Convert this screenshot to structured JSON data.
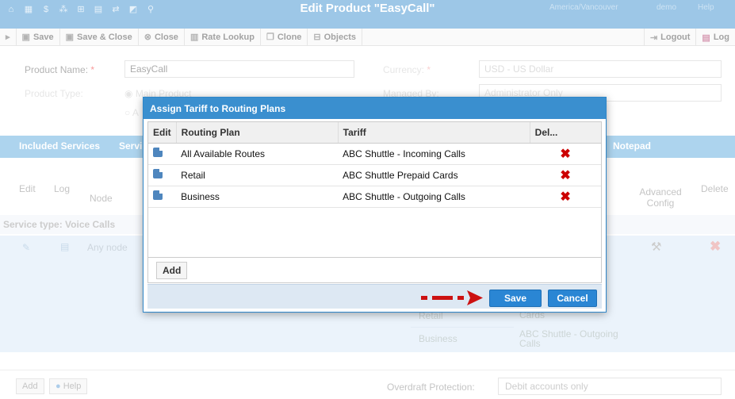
{
  "titlebar": {
    "title": "Edit Product \"EasyCall\"",
    "timezone": "America/Vancouver",
    "user": "demo",
    "help": "Help",
    "icons": [
      "home-icon",
      "grid-icon",
      "dollar-icon",
      "network-icon",
      "plus-icon",
      "layout-icon",
      "flow-icon",
      "chart-icon",
      "search-icon"
    ]
  },
  "toolbar": {
    "save": "Save",
    "save_close": "Save & Close",
    "close": "Close",
    "rate_lookup": "Rate Lookup",
    "clone": "Clone",
    "objects": "Objects",
    "logout": "Logout",
    "log": "Log"
  },
  "form": {
    "product_name_label": "Product Name:",
    "product_name_value": "EasyCall",
    "currency_label": "Currency:",
    "currency_value": "USD - US Dollar",
    "product_type_label": "Product Type:",
    "product_type_option": "Main Product",
    "product_type_option2": "A",
    "managed_by_label": "Managed By:",
    "managed_by_value": "Administrator Only"
  },
  "tabs": {
    "included_services": "Included Services",
    "services_partial": "Servi",
    "notepad": "Notepad"
  },
  "services": {
    "col_edit": "Edit",
    "col_log": "Log",
    "col_node": "Node",
    "col_advanced": "Advanced Config",
    "col_delete": "Delete",
    "band_label": "Service type: Voice Calls",
    "row_node": "Any node",
    "bg_rows": [
      {
        "plan": "Retail",
        "tariff": "ABC Shuttle Prepaid Cards"
      },
      {
        "plan": "Business",
        "tariff": "ABC Shuttle - Outgoing Calls"
      }
    ]
  },
  "footer": {
    "add": "Add",
    "help": "Help",
    "overdraft_label": "Overdraft Protection:",
    "overdraft_value": "Debit accounts only"
  },
  "dialog": {
    "title": "Assign Tariff to Routing Plans",
    "headers": {
      "edit": "Edit",
      "routing_plan": "Routing Plan",
      "tariff": "Tariff",
      "delete": "Del..."
    },
    "rows": [
      {
        "plan": "All Available Routes",
        "tariff": "ABC Shuttle - Incoming Calls"
      },
      {
        "plan": "Retail",
        "tariff": "ABC Shuttle Prepaid Cards"
      },
      {
        "plan": "Business",
        "tariff": "ABC Shuttle - Outgoing Calls"
      }
    ],
    "add": "Add",
    "save": "Save",
    "cancel": "Cancel"
  },
  "colors": {
    "accent": "#3a8fcf",
    "arrow": "#cc1111",
    "delete": "#cc0000"
  }
}
